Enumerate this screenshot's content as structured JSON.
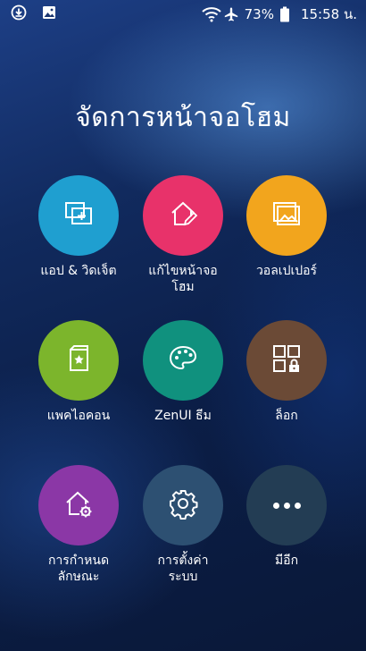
{
  "status_bar": {
    "battery": "73%",
    "time": "15:58 น."
  },
  "page": {
    "title": "จัดการหน้าจอโฮม"
  },
  "tiles": [
    {
      "label": "แอป & วิดเจ็ต",
      "icon": "apps-widgets-icon",
      "color": "#1f9fd0"
    },
    {
      "label": "แก้ไขหน้าจอ\nโฮม",
      "icon": "edit-home-icon",
      "color": "#e8326a"
    },
    {
      "label": "วอลเปเปอร์",
      "icon": "wallpaper-icon",
      "color": "#f2a51d"
    },
    {
      "label": "แพคไอคอน",
      "icon": "icon-pack-icon",
      "color": "#7cb52c"
    },
    {
      "label": "ZenUI ธีม",
      "icon": "palette-icon",
      "color": "#10917e"
    },
    {
      "label": "ล็อก",
      "icon": "lock-layout-icon",
      "color": "#6b4a36"
    },
    {
      "label": "การกำหนด\nลักษณะ",
      "icon": "home-settings-icon",
      "color": "#8b37a6"
    },
    {
      "label": "การตั้งค่า\nระบบ",
      "icon": "gear-icon",
      "color": "#2d5072"
    },
    {
      "label": "มีอีก",
      "icon": "more-dots-icon",
      "color": "#233d54"
    }
  ]
}
